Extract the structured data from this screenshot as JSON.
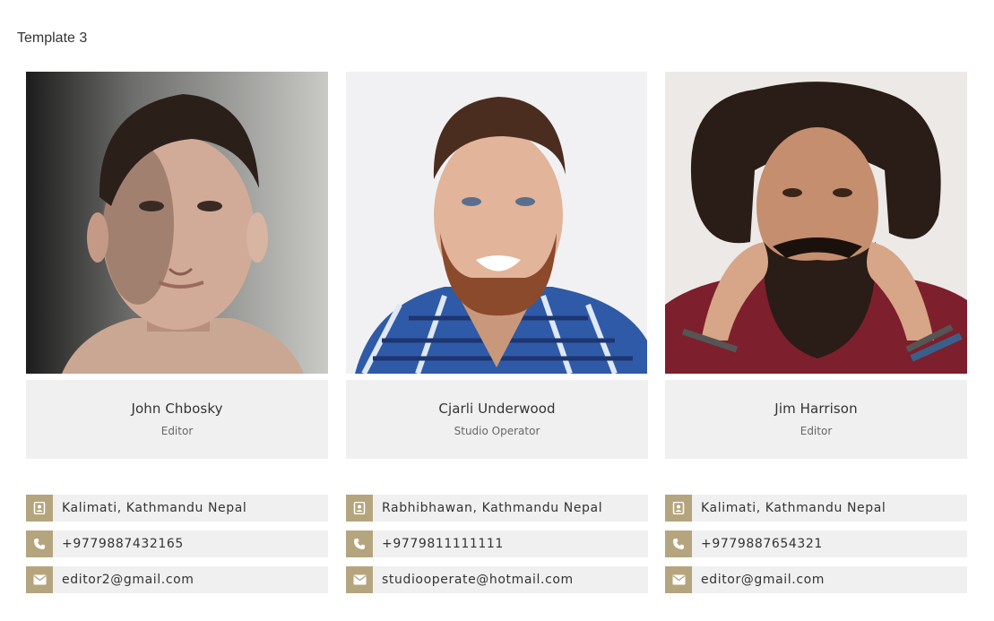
{
  "page": {
    "title": "Template 3"
  },
  "colors": {
    "accent": "#b5a57e",
    "panel": "#f0f0f0"
  },
  "members": [
    {
      "name": "John Chbosky",
      "role": "Editor",
      "address": "Kalimati, Kathmandu Nepal",
      "phone": "+9779887432165",
      "email": "editor2@gmail.com"
    },
    {
      "name": "Cjarli Underwood",
      "role": "Studio Operator",
      "address": "Rabhibhawan, Kathmandu Nepal",
      "phone": "+9779811111111",
      "email": "studiooperate@hotmail.com"
    },
    {
      "name": "Jim Harrison",
      "role": "Editor",
      "address": "Kalimati, Kathmandu Nepal",
      "phone": "+9779887654321",
      "email": "editor@gmail.com"
    }
  ],
  "icons": {
    "address": "contact-card-icon",
    "phone": "phone-icon",
    "email": "envelope-icon"
  }
}
